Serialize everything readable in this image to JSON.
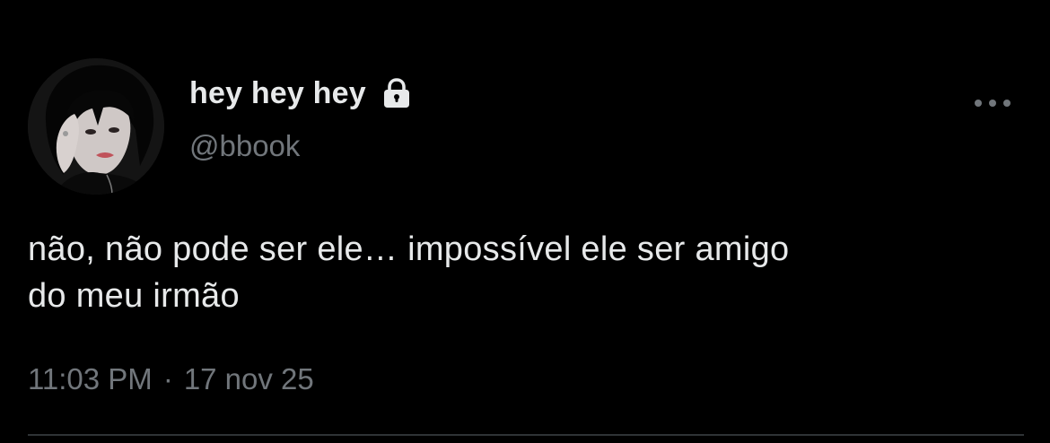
{
  "tweet": {
    "author": {
      "display_name": "hey hey hey",
      "handle": "@bbook",
      "protected_icon": "lock-icon",
      "avatar": "profile-photo"
    },
    "more_icon": "more-horizontal-icon",
    "text_line1": "não, não pode ser ele… impossível ele ser amigo",
    "text_line2": "do meu irmão",
    "time": "11:03 PM",
    "separator": "·",
    "date": "17 nov 25"
  },
  "colors": {
    "background": "#000000",
    "primary_text": "#e7e9ea",
    "secondary_text": "#71767b",
    "divider": "#2f3336"
  }
}
